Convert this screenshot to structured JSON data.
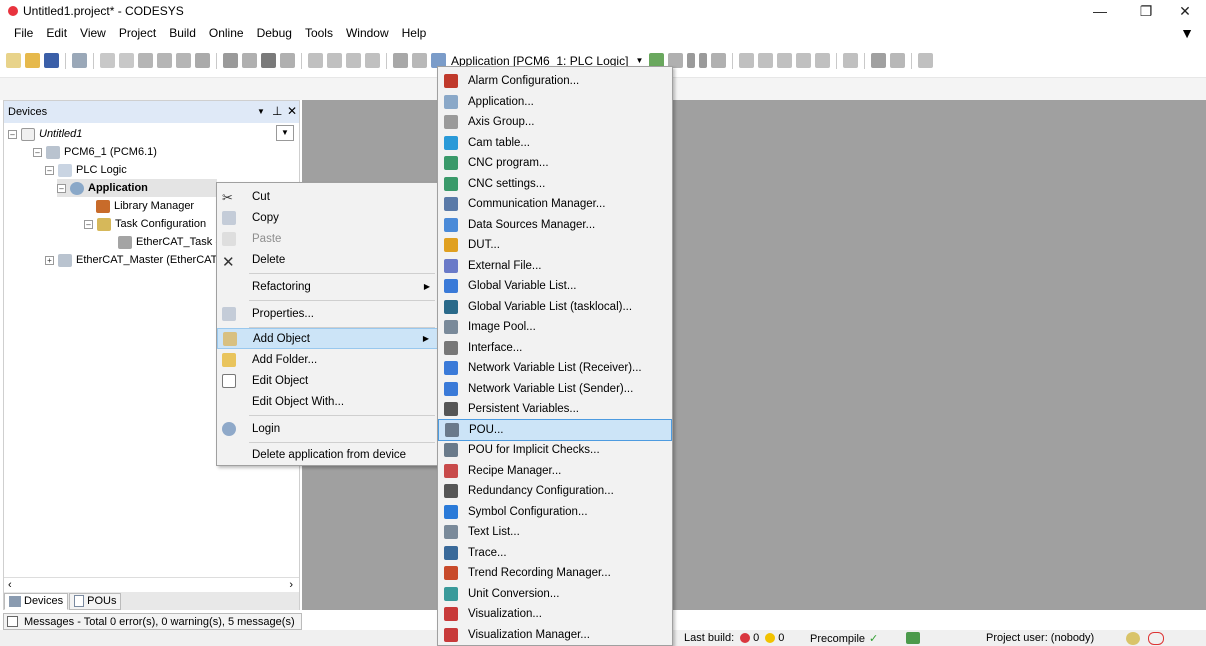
{
  "window": {
    "title": "Untitled1.project* - CODESYS"
  },
  "menubar": {
    "items": [
      "File",
      "Edit",
      "View",
      "Project",
      "Build",
      "Online",
      "Debug",
      "Tools",
      "Window",
      "Help"
    ]
  },
  "toolbar": {
    "application_combo": "Application [PCM6_1: PLC Logic]"
  },
  "devices_pane": {
    "title": "Devices",
    "tree": {
      "root": "Untitled1",
      "device": "PCM6_1 (PCM6.1)",
      "plc_logic": "PLC Logic",
      "application": "Application",
      "library_manager": "Library Manager",
      "task_configuration": "Task Configuration",
      "ethercat_task": "EtherCAT_Task (",
      "ethercat_master": "EtherCAT_Master (EtherCAT"
    },
    "tabs": [
      "Devices",
      "POUs"
    ]
  },
  "messages_bar": {
    "text": "Messages - Total 0 error(s), 0 warning(s), 5 message(s)"
  },
  "context_menu": {
    "cut": "Cut",
    "copy": "Copy",
    "paste": "Paste",
    "delete": "Delete",
    "refactoring": "Refactoring",
    "properties": "Properties...",
    "add_object": "Add Object",
    "add_folder": "Add Folder...",
    "edit_object": "Edit Object",
    "edit_object_with": "Edit Object With...",
    "login": "Login",
    "delete_app": "Delete application from device"
  },
  "add_object_submenu": [
    "Alarm Configuration...",
    "Application...",
    "Axis Group...",
    "Cam table...",
    "CNC program...",
    "CNC settings...",
    "Communication Manager...",
    "Data Sources Manager...",
    "DUT...",
    "External File...",
    "Global Variable List...",
    "Global Variable List (tasklocal)...",
    "Image Pool...",
    "Interface...",
    "Network Variable List (Receiver)...",
    "Network Variable List (Sender)...",
    "Persistent Variables...",
    "POU...",
    "POU for Implicit Checks...",
    "Recipe Manager...",
    "Redundancy Configuration...",
    "Symbol Configuration...",
    "Text List...",
    "Trace...",
    "Trend Recording Manager...",
    "Unit Conversion...",
    "Visualization...",
    "Visualization Manager..."
  ],
  "status": {
    "last_build_label": "Last build:",
    "errors": "0",
    "warnings": "0",
    "precompile": "Precompile",
    "project_user": "Project user: (nobody)"
  },
  "colors": {
    "highlight": "#cce4f7",
    "workspace": "#a0a0a0",
    "pane_header": "#dfe9f7"
  }
}
